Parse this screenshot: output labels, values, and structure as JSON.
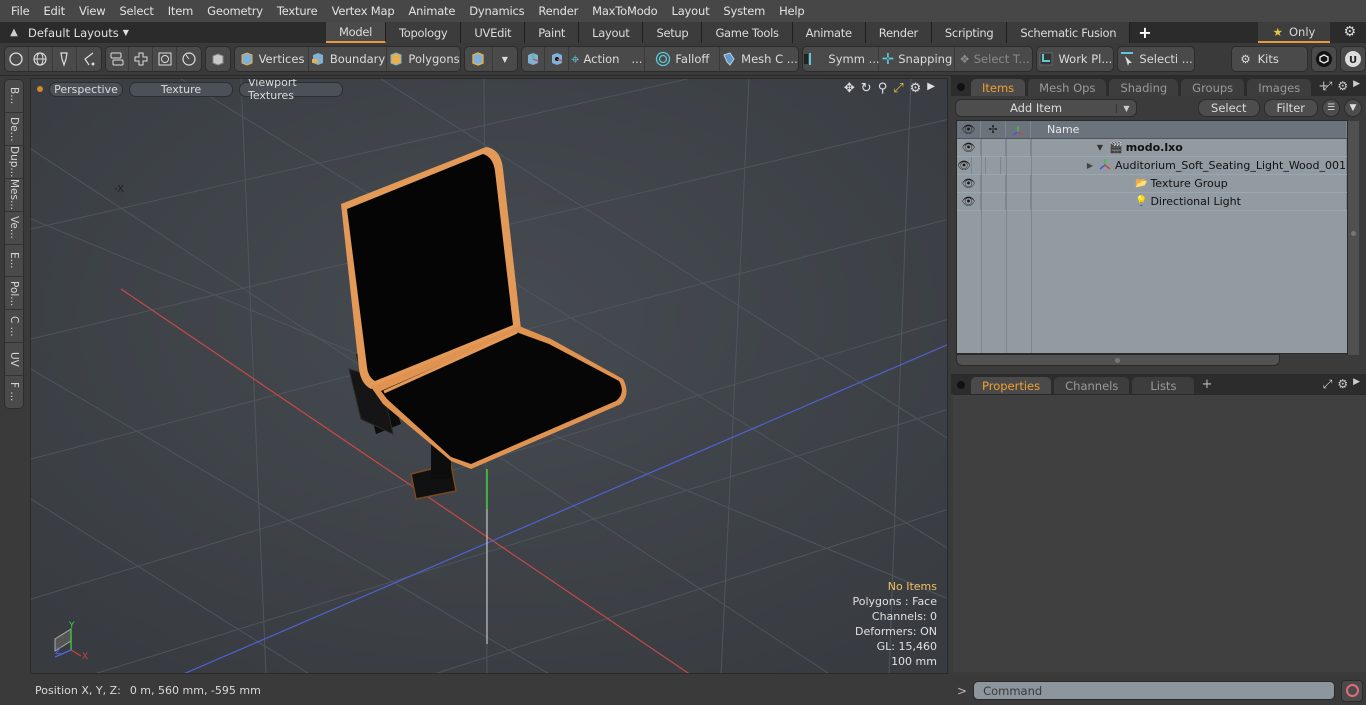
{
  "menu": [
    "File",
    "Edit",
    "View",
    "Select",
    "Item",
    "Geometry",
    "Texture",
    "Vertex Map",
    "Animate",
    "Dynamics",
    "Render",
    "MaxToModo",
    "Layout",
    "System",
    "Help"
  ],
  "layouts": {
    "selector_label": "Default Layouts",
    "tabs": [
      "Model",
      "Topology",
      "UVEdit",
      "Paint",
      "Layout",
      "Setup",
      "Game Tools",
      "Animate",
      "Render",
      "Scripting",
      "Schematic Fusion"
    ],
    "active_tab": "Model",
    "add_label": "+",
    "only_label": "Only"
  },
  "toolbar": {
    "select_modes": [
      "Vertices",
      "Boundary",
      "Polygons"
    ],
    "action_label": "Action",
    "action_more": "...",
    "falloff_label": "Falloff",
    "mesh_label": "Mesh C ...",
    "symm_label": "Symm ...",
    "snapping_label": "Snapping",
    "select_t_label": "Select T...",
    "workplane_label": "Work Pl...",
    "selection_label": "Selecti ...",
    "kits_label": "Kits"
  },
  "left_tabs": [
    "B...",
    "De...",
    "Dup...",
    "Mes...",
    "Ve...",
    "E...",
    "Pol...",
    "C ...",
    "UV",
    "F ..."
  ],
  "viewport": {
    "view_label": "Perspective",
    "shading_label": "Texture",
    "textures_label": "Viewport Textures",
    "axis_label_neg_x": "-X",
    "gizmo": {
      "x": "X",
      "y": "Y",
      "z": "Z"
    },
    "stats": {
      "selection": "No Items",
      "polygons": "Polygons : Face",
      "channels": "Channels: 0",
      "deformers": "Deformers: ON",
      "gl": "GL: 15,460",
      "grid": "100 mm"
    },
    "colors": {
      "accent": "#e59a3b",
      "chair_edge": "#e0904a",
      "grid": "#4d5359",
      "x_axis": "#d04040",
      "y_axis": "#40c040",
      "z_axis": "#4a5ad0"
    }
  },
  "status": {
    "position_label": "Position X, Y, Z:",
    "position_value": "0 m, 560 mm, -595 mm"
  },
  "items_panel": {
    "tabs": [
      "Items",
      "Mesh Ops",
      "Shading",
      "Groups",
      "Images"
    ],
    "active_tab": "Items",
    "add_item_label": "Add Item",
    "select_label": "Select",
    "filter_label": "Filter",
    "name_header": "Name",
    "rows": [
      {
        "name": "modo.lxo",
        "icon": "scene-icon",
        "bold": true,
        "expander": "expanded"
      },
      {
        "name": "Auditorium_Soft_Seating_Light_Wood_001",
        "icon": "mesh-locator-icon",
        "bold": false,
        "expander": "collapsed"
      },
      {
        "name": "Texture Group",
        "icon": "folder-icon",
        "bold": false,
        "expander": "none"
      },
      {
        "name": "Directional Light",
        "icon": "light-icon",
        "bold": false,
        "expander": "none"
      }
    ]
  },
  "properties_panel": {
    "tabs": [
      "Properties",
      "Channels",
      "Lists"
    ],
    "active_tab": "Properties"
  },
  "command": {
    "placeholder": "Command",
    "prompt": ">"
  }
}
